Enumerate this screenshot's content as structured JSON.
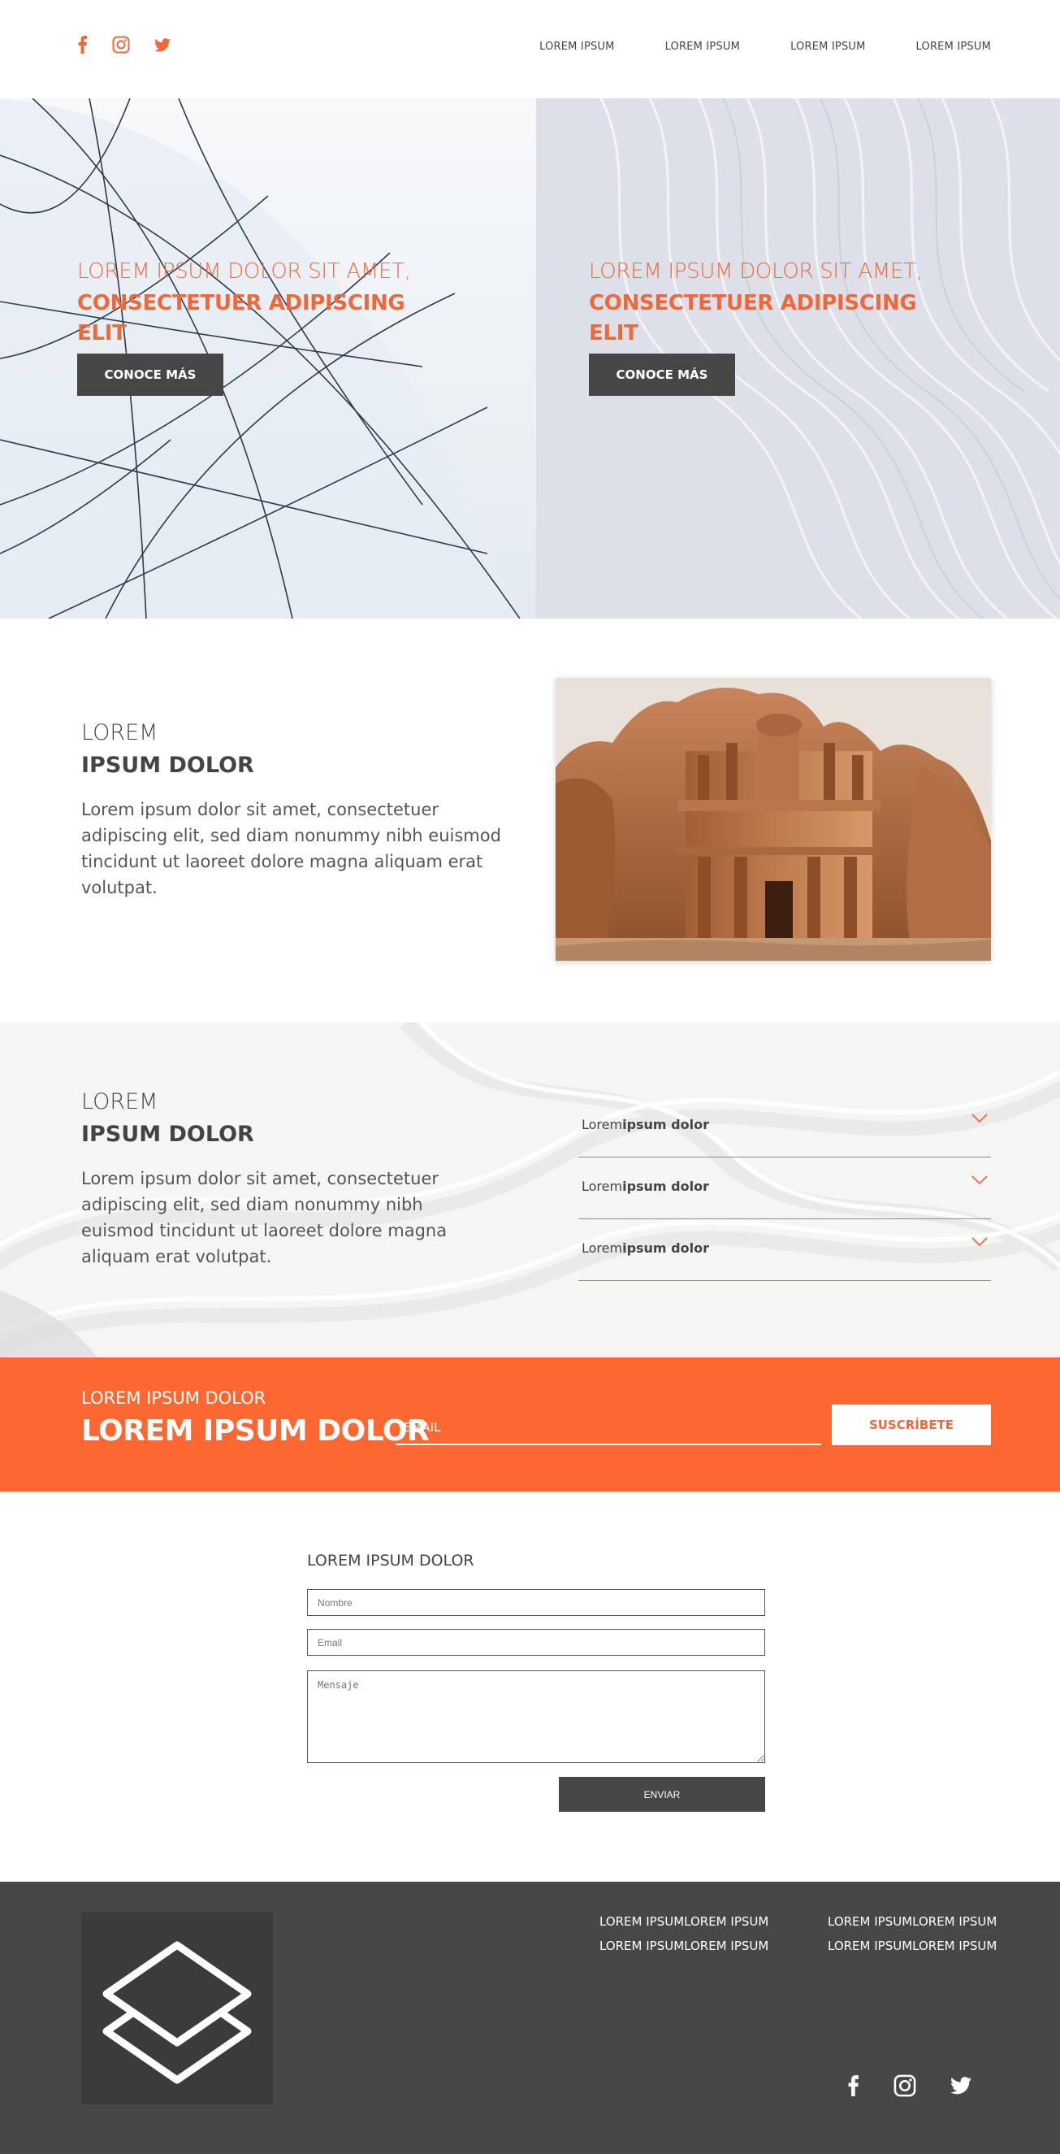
{
  "header": {
    "social": [
      "facebook-icon",
      "instagram-icon",
      "twitter-icon"
    ],
    "nav": [
      "LOREM IPSUM",
      "LOREM IPSUM",
      "LOREM IPSUM",
      "LOREM IPSUM"
    ]
  },
  "hero": [
    {
      "line1": "LOREM IPSUM DOLOR SIT AMET,",
      "line2": "CONSECTETUER ADIPISCING",
      "line3": "ELIT",
      "button": "CONOCE MÁS"
    },
    {
      "line1": "LOREM IPSUM DOLOR SIT AMET,",
      "line2": "CONSECTETUER ADIPISCING",
      "line3": "ELIT",
      "button": "CONOCE MÁS"
    }
  ],
  "about": {
    "title_light": "LOREM",
    "title_bold": "IPSUM DOLOR",
    "text": "Lorem ipsum dolor sit amet, consectetuer adipiscing elit, sed diam nonummy nibh euismod tincidunt ut laoreet dolore magna aliquam erat volutpat."
  },
  "features": {
    "title_light": "LOREM",
    "title_bold": "IPSUM DOLOR",
    "text": "Lorem ipsum dolor sit amet, consectetuer adipiscing elit, sed diam nonummy nibh euismod tincidunt ut laoreet dolore magna aliquam erat volutpat.",
    "accordion": [
      {
        "light": "Lorem",
        "bold": "ipsum dolor"
      },
      {
        "light": "Lorem",
        "bold": "ipsum dolor"
      },
      {
        "light": "Lorem",
        "bold": "ipsum dolor"
      }
    ]
  },
  "newsletter": {
    "small": "LOREM IPSUM DOLOR",
    "big": "LOREM IPSUM DOLOR",
    "email_placeholder": "EMAIL",
    "button": "SUSCRÍBETE"
  },
  "contact": {
    "title": "LOREM IPSUM DOLOR",
    "name_placeholder": "Nombre",
    "email_placeholder": "Email",
    "message_placeholder": "Mensaje",
    "button": "ENVIAR"
  },
  "footer": {
    "col1": [
      "LOREM IPSUMLOREM IPSUM",
      "LOREM IPSUMLOREM IPSUM"
    ],
    "col2": [
      "LOREM IPSUMLOREM IPSUM",
      "LOREM IPSUMLOREM IPSUM"
    ],
    "social": [
      "facebook-icon",
      "instagram-icon",
      "twitter-icon"
    ]
  },
  "colors": {
    "accent": "#fd6832",
    "dark": "#464646",
    "footer_bg": "#474747",
    "text": "#444444"
  }
}
